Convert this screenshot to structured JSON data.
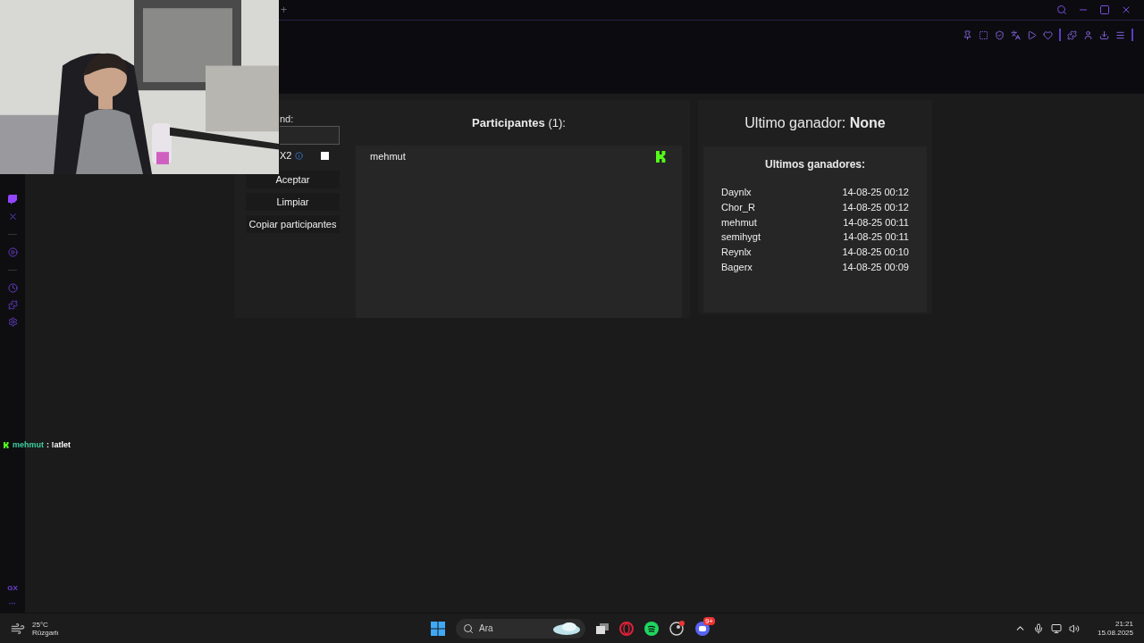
{
  "browser": {
    "new_tab": "+"
  },
  "form": {
    "label": "nd:",
    "multiplier": "X2",
    "multiplier_checked": false,
    "buttons": [
      "Aceptar",
      "Limpiar",
      "Copiar participantes"
    ]
  },
  "participants": {
    "title": "Participantes",
    "count": "(1):",
    "items": [
      {
        "name": "mehmut"
      }
    ]
  },
  "last_winner": {
    "label": "Ultimo ganador:",
    "value": "None"
  },
  "winners": {
    "title": "Ultimos ganadores:",
    "rows": [
      {
        "name": "Daynlx",
        "time": "14-08-25 00:12"
      },
      {
        "name": "Chor_R",
        "time": "14-08-25 00:12"
      },
      {
        "name": "mehmut",
        "time": "14-08-25 00:11"
      },
      {
        "name": "semihygt",
        "time": "14-08-25 00:11"
      },
      {
        "name": "Reynlx",
        "time": "14-08-25 00:10"
      },
      {
        "name": "Bagerx",
        "time": "14-08-25 00:09"
      }
    ]
  },
  "chat": [
    {
      "user": "mehmut",
      "message": ": !atlet"
    }
  ],
  "sidebar": {
    "footer": "GX",
    "more": "···"
  },
  "taskbar": {
    "temperature": "25°C",
    "weather": "Rüzgarlı",
    "search_placeholder": "Ara",
    "discord_badge": "9+",
    "time": "21:21",
    "date": "15.08.2025"
  }
}
